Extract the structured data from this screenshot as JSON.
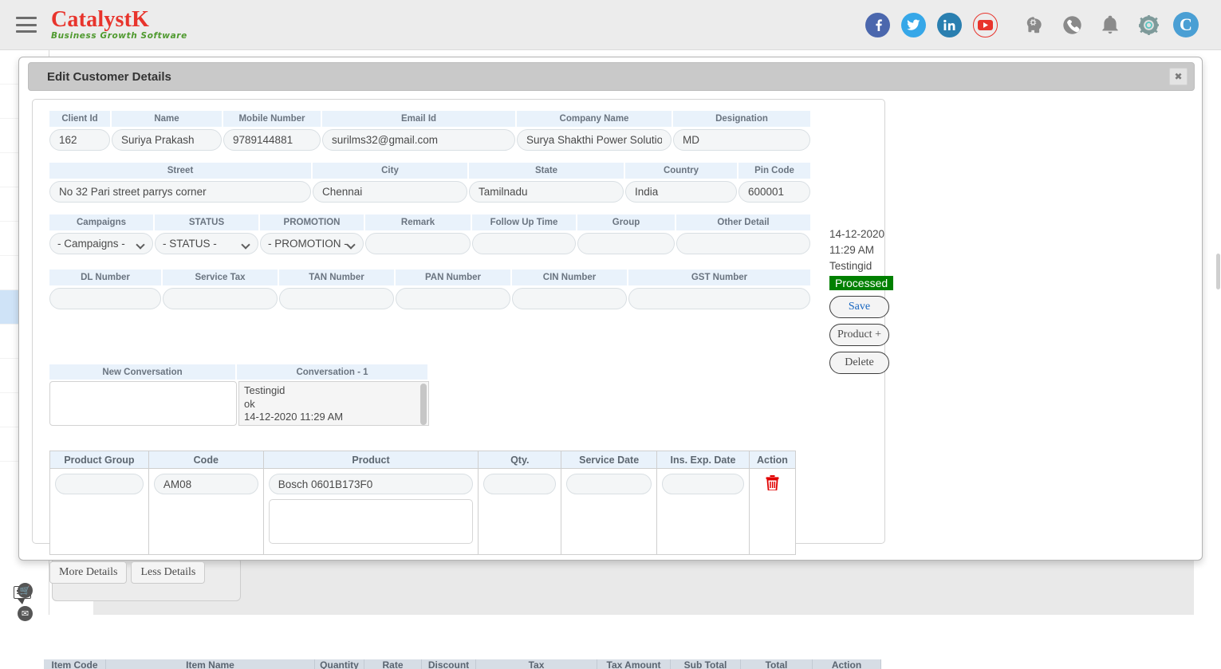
{
  "topbar": {
    "brand_name": "CatalystK",
    "brand_tagline": "Business Growth Software",
    "menu_icon": "hamburger-menu-icon",
    "icons": [
      {
        "name": "facebook-icon",
        "glyph": "f"
      },
      {
        "name": "twitter-icon",
        "glyph": ""
      },
      {
        "name": "linkedin-icon",
        "glyph": "in"
      },
      {
        "name": "youtube-icon",
        "glyph": ""
      },
      {
        "name": "ai-brain-icon",
        "glyph": ""
      },
      {
        "name": "phone-icon",
        "glyph": ""
      },
      {
        "name": "bell-notification-icon",
        "glyph": ""
      },
      {
        "name": "settings-gear-icon",
        "glyph": ""
      },
      {
        "name": "user-avatar",
        "glyph": "C"
      }
    ]
  },
  "modal": {
    "title": "Edit Customer Details",
    "close_label": "✖"
  },
  "form": {
    "row1": {
      "labels": [
        "Client Id",
        "Name",
        "Mobile Number",
        "Email Id",
        "Company Name",
        "Designation"
      ],
      "values": [
        "162",
        "Suriya Prakash",
        "9789144881",
        "surilms32@gmail.com",
        "Surya Shakthi Power Solutions",
        "MD"
      ]
    },
    "row2": {
      "labels": [
        "Street",
        "City",
        "State",
        "Country",
        "Pin Code"
      ],
      "values": [
        "No 32 Pari street parrys corner",
        "Chennai",
        "Tamilnadu",
        "India",
        "600001"
      ]
    },
    "row3": {
      "labels": [
        "Campaigns",
        "STATUS",
        "PROMOTION",
        "Remark",
        "Follow Up Time",
        "Group",
        "Other Detail"
      ],
      "selects": [
        "- Campaigns -",
        "- STATUS -",
        "- PROMOTION -"
      ],
      "values": [
        "",
        "",
        "",
        ""
      ]
    },
    "row4": {
      "labels": [
        "DL Number",
        "Service Tax",
        "TAN Number",
        "PAN Number",
        "CIN Number",
        "GST Number"
      ],
      "values": [
        "",
        "",
        "",
        "",
        "",
        ""
      ]
    }
  },
  "conversation": {
    "new_label": "New Conversation",
    "existing_label": "Conversation - 1",
    "new_value": "",
    "existing_value": "Testingid\nok\n14-12-2020 11:29 AM"
  },
  "product_table": {
    "headers": [
      "Product Group",
      "Code",
      "Product",
      "Qty.",
      "Service Date",
      "Ins. Exp. Date",
      "Action"
    ],
    "rows": [
      {
        "product_group": "",
        "code": "AM08",
        "product": "Bosch 0601B173F0",
        "product_note": "",
        "qty": "",
        "service_date": "",
        "ins_exp_date": "",
        "action_icon": "delete-trash-icon"
      }
    ]
  },
  "detail_buttons": {
    "more": "More Details",
    "less": "Less Details"
  },
  "side_panel": {
    "date": "14-12-2020",
    "time": "11:29 AM",
    "user": "Testingid",
    "status_badge": "Processed",
    "status_color": "#008000",
    "save_label": "Save",
    "product_add_label": "Product +",
    "delete_label": "Delete"
  },
  "background": {
    "table_headers": [
      "Item Code",
      "Item Name",
      "Quantity",
      "Rate",
      "Discount",
      "Tax",
      "Tax Amount",
      "Sub Total",
      "Total",
      "Action"
    ]
  }
}
